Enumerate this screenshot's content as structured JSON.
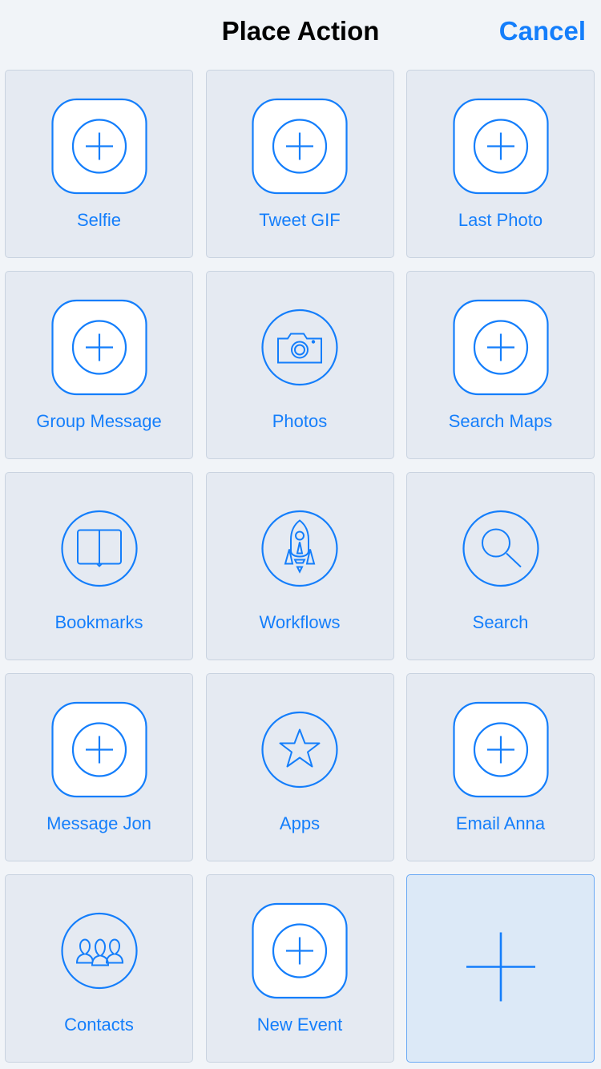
{
  "header": {
    "title": "Place Action",
    "cancel_label": "Cancel"
  },
  "colors": {
    "accent": "#147efb",
    "tile_bg": "#e5eaf2",
    "page_bg": "#f1f4f8"
  },
  "tiles": [
    {
      "label": "Selfie",
      "icon": "plus-square"
    },
    {
      "label": "Tweet GIF",
      "icon": "plus-square"
    },
    {
      "label": "Last Photo",
      "icon": "plus-square"
    },
    {
      "label": "Group Message",
      "icon": "plus-square"
    },
    {
      "label": "Photos",
      "icon": "camera"
    },
    {
      "label": "Search Maps",
      "icon": "plus-square"
    },
    {
      "label": "Bookmarks",
      "icon": "book"
    },
    {
      "label": "Workflows",
      "icon": "rocket"
    },
    {
      "label": "Search",
      "icon": "magnifier"
    },
    {
      "label": "Message Jon",
      "icon": "plus-square"
    },
    {
      "label": "Apps",
      "icon": "star"
    },
    {
      "label": "Email Anna",
      "icon": "plus-square"
    },
    {
      "label": "Contacts",
      "icon": "people"
    },
    {
      "label": "New Event",
      "icon": "plus-square"
    }
  ],
  "add_tile": {
    "icon": "plus"
  }
}
